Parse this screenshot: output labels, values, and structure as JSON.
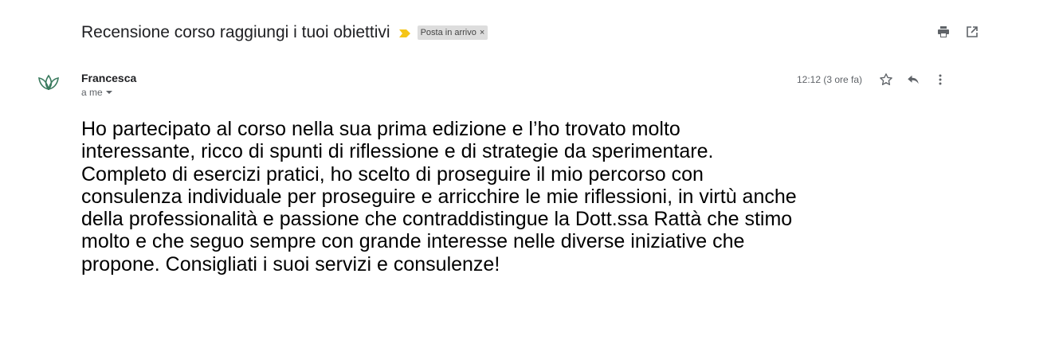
{
  "email": {
    "subject": "Recensione corso raggiungi i tuoi obiettivi",
    "label": "Posta in arrivo",
    "label_remove": "×",
    "sender": "Francesca",
    "recipient": "a me",
    "timestamp": "12:12 (3 ore fa)",
    "body_lines": [
      "Ho partecipato al corso nella sua prima edizione e l’ho trovato molto",
      "interessante, ricco di spunti di riflessione e di strategie da sperimentare.",
      "Completo di esercizi pratici, ho scelto di proseguire il mio percorso con",
      "consulenza individuale per proseguire e arricchire le mie riflessioni, in virtù anche",
      "della professionalità e passione che contraddistingue la Dott.ssa Rattà che stimo",
      "molto e che seguo sempre con grande interesse nelle diverse iniziative che",
      "propone. Consigliati i suoi servizi e consulenze!"
    ]
  },
  "icons": {
    "importance": "importance-marker-icon",
    "print": "print-icon",
    "new_window": "open-in-new-window-icon",
    "avatar": "lotus-logo-icon",
    "star": "star-icon",
    "reply": "reply-icon",
    "more": "more-vert-icon"
  },
  "colors": {
    "importance": "#f5c518",
    "label_bg": "#dddddd",
    "avatar_stroke": "#3a7a5e",
    "text": "#202124",
    "muted": "#5f6368"
  }
}
